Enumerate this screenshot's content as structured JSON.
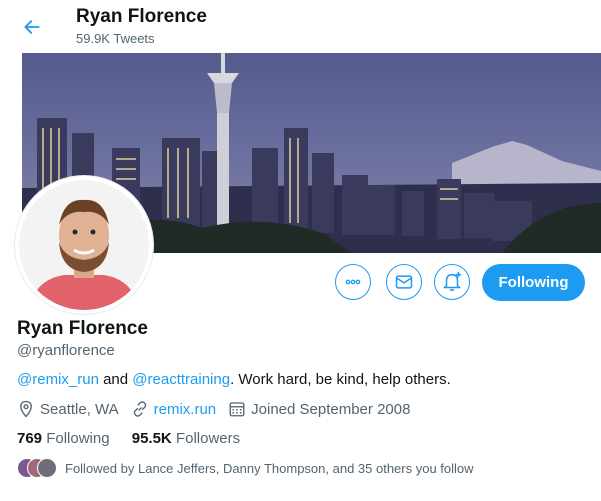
{
  "header": {
    "title": "Ryan Florence",
    "tweet_count": "59.9K Tweets"
  },
  "profile": {
    "name": "Ryan Florence",
    "handle": "@ryanflorence",
    "bio": {
      "mention1": "@remix_run",
      "and": " and ",
      "mention2": "@reacttraining",
      "rest": ". Work hard, be kind, help others."
    },
    "location": "Seattle, WA",
    "website": "remix.run",
    "joined": "Joined September 2008",
    "following_count": "769",
    "following_label": " Following",
    "followers_count": "95.5K",
    "followers_label": " Followers",
    "followed_by": "Followed by Lance Jeffers, Danny Thompson, and 35 others you follow"
  },
  "actions": {
    "follow_label": "Following"
  },
  "icons": {
    "back": "arrow-left-icon",
    "more": "more-horizontal-icon",
    "message": "envelope-icon",
    "notify": "bell-plus-icon",
    "location": "location-pin-icon",
    "website": "link-icon",
    "joined": "calendar-icon"
  },
  "colors": {
    "accent": "#1d9bf0",
    "secondary_text": "#536471",
    "primary_text": "#0f1419"
  }
}
